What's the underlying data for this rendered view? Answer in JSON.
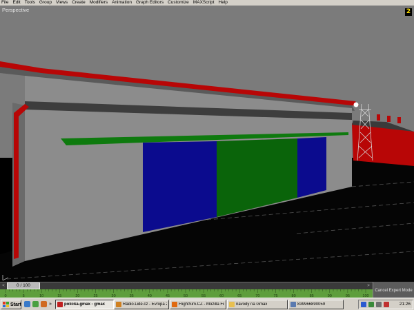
{
  "app": {
    "menu": [
      "File",
      "Edit",
      "Tools",
      "Group",
      "Views",
      "Create",
      "Modifiers",
      "Animation",
      "Graph Editors",
      "Customize",
      "MAXScript",
      "Help"
    ]
  },
  "viewport": {
    "label": "Perspective",
    "nav_button": "2"
  },
  "timeslider": {
    "position": "0 / 100",
    "left_arrow": "<",
    "right_arrow": ">"
  },
  "trackbar": {
    "ticks": [
      "0",
      "5",
      "10",
      "15",
      "20",
      "25",
      "30",
      "35",
      "40",
      "45",
      "50",
      "55",
      "60",
      "65",
      "70",
      "75",
      "80",
      "85",
      "90",
      "95",
      "100"
    ]
  },
  "expert_mode": {
    "cancel_label": "Cancel Expert Mode"
  },
  "taskbar": {
    "start_label": "Start",
    "quicklaunch_more": "»",
    "tasks": [
      {
        "label": "policka.gmax - gmax",
        "active": true,
        "icon": "gmax-icon",
        "color": "#c02020"
      },
      {
        "label": "Rádio.Lidé.cz - Evropa 2 ...",
        "active": false,
        "icon": "radio-icon",
        "color": "#d08020"
      },
      {
        "label": "FlightSim.CZ - Mozilla Fir...",
        "active": false,
        "icon": "firefox-icon",
        "color": "#e06a10"
      },
      {
        "label": "navody na Gmax",
        "active": false,
        "icon": "folder-icon",
        "color": "#e8c050"
      },
      {
        "label": "839966890059",
        "active": false,
        "icon": "document-icon",
        "color": "#5a7ab0"
      }
    ],
    "clock": "21:26"
  },
  "colors": {
    "building_grey": "#7b7b7b",
    "door_blue": "#0b0b8e",
    "door_green": "#0a640a",
    "canopy_green": "#0e7a0e",
    "red_trim": "#b80606",
    "trackbar_green": "#5e9e3c",
    "nav_yellow": "#ffe000"
  }
}
